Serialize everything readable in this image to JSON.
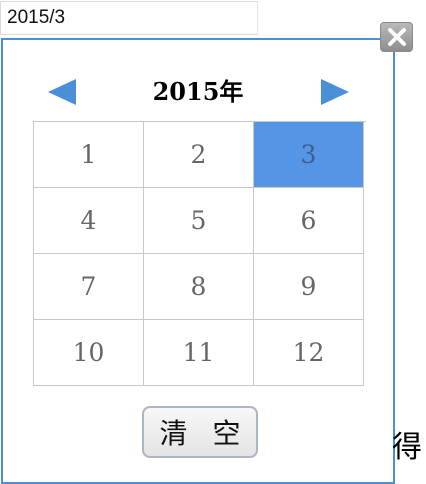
{
  "input": {
    "value": "2015/3"
  },
  "close": {
    "icon": "close-icon"
  },
  "picker": {
    "year_title": "2015年",
    "prev_icon": "triangle-left-icon",
    "next_icon": "triangle-right-icon",
    "accent_color": "#5595e6",
    "months": [
      "1",
      "2",
      "3",
      "4",
      "5",
      "6",
      "7",
      "8",
      "9",
      "10",
      "11",
      "12"
    ],
    "selected_month": "3",
    "clear_label": "清 空"
  },
  "background_text": "得"
}
